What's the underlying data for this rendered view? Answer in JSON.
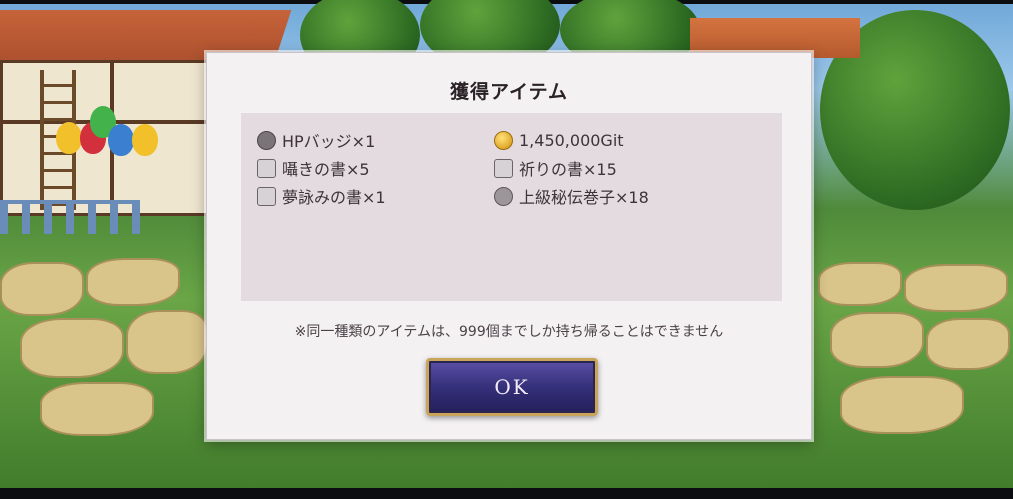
{
  "dialog": {
    "title": "獲得アイテム",
    "items_left": [
      {
        "icon": "badge-icon",
        "label": "HPバッジ×1"
      },
      {
        "icon": "book-icon",
        "label": "囁きの書×5"
      },
      {
        "icon": "book-icon",
        "label": "夢詠みの書×1"
      }
    ],
    "items_right": [
      {
        "icon": "coin-icon",
        "label": "1,450,000Git"
      },
      {
        "icon": "book-icon",
        "label": "祈りの書×15"
      },
      {
        "icon": "scroll-icon",
        "label": "上級秘伝巻子×18"
      }
    ],
    "notice": "※同一種類のアイテムは、999個までしか持ち帰ることはできません",
    "ok_label": "OK"
  },
  "colors": {
    "dialog_bg": "#f4f1f3",
    "panel_bg": "#e4dbe0",
    "button_fill": "#35307a",
    "button_border": "#c8a55a"
  }
}
